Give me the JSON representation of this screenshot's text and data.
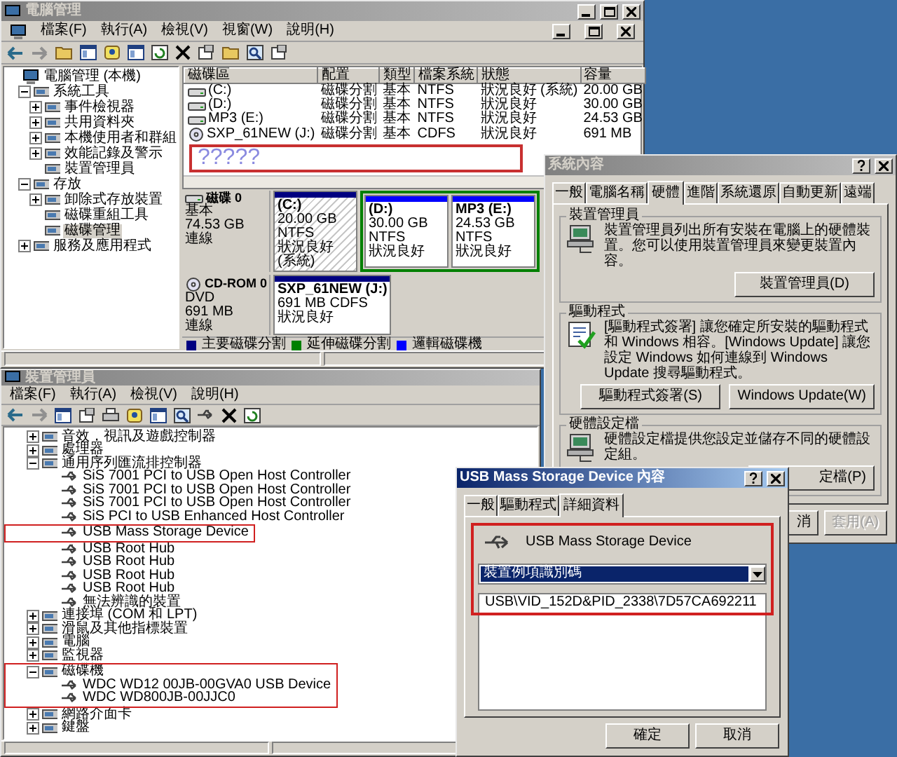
{
  "computer_management": {
    "title": "電腦管理",
    "menu": [
      "檔案(F)",
      "執行(A)",
      "檢視(V)",
      "視窗(W)",
      "說明(H)"
    ],
    "tree": [
      {
        "label": "電腦管理 (本機)",
        "selected": false,
        "children": [
          {
            "label": "系統工具",
            "expanded": true,
            "selected": false,
            "children": [
              {
                "label": "事件檢視器",
                "expanded": false,
                "selected": false
              },
              {
                "label": "共用資料夾",
                "expanded": false,
                "selected": false
              },
              {
                "label": "本機使用者和群組",
                "expanded": false,
                "selected": false
              },
              {
                "label": "效能記錄及警示",
                "expanded": false,
                "selected": false
              },
              {
                "label": "裝置管理員",
                "selected": false
              }
            ]
          },
          {
            "label": "存放",
            "expanded": true,
            "selected": false,
            "children": [
              {
                "label": "卸除式存放裝置",
                "expanded": false,
                "selected": false
              },
              {
                "label": "磁碟重組工具",
                "selected": false
              },
              {
                "label": "磁碟管理",
                "selected": true
              }
            ]
          },
          {
            "label": "服務及應用程式",
            "expanded": false,
            "selected": false
          }
        ]
      }
    ],
    "volumes": {
      "columns": [
        "磁碟區",
        "配置",
        "類型",
        "檔案系統",
        "狀態",
        "容量"
      ],
      "rows": [
        {
          "kind": "disk",
          "cells": [
            "(C:)",
            "磁碟分割",
            "基本",
            "NTFS",
            "狀況良好 (系統)",
            "20.00 GB"
          ]
        },
        {
          "kind": "disk",
          "cells": [
            "(D:)",
            "磁碟分割",
            "基本",
            "NTFS",
            "狀況良好",
            "30.00 GB"
          ]
        },
        {
          "kind": "disk",
          "cells": [
            "MP3 (E:)",
            "磁碟分割",
            "基本",
            "NTFS",
            "狀況良好",
            "24.53 GB"
          ]
        },
        {
          "kind": "cd",
          "cells": [
            "SXP_61NEW (J:)",
            "磁碟分割",
            "基本",
            "CDFS",
            "狀況良好",
            "691 MB"
          ]
        }
      ]
    },
    "annotation": "?????",
    "disks": [
      {
        "kind": "disk",
        "name": "磁碟 0",
        "type": "基本",
        "size": "74.53 GB",
        "status": "連線",
        "partitions": [
          {
            "kind": "primary",
            "selected": true,
            "label": "(C:)",
            "detail": "20.00 GB NTFS",
            "status": "狀況良好 (系統)"
          },
          {
            "kind": "logical",
            "selected": false,
            "label": "(D:)",
            "detail": "30.00 GB NTFS",
            "status": "狀況良好"
          },
          {
            "kind": "logical",
            "selected": false,
            "label": "MP3  (E:)",
            "detail": "24.53 GB NTFS",
            "status": "狀況良好"
          }
        ]
      },
      {
        "kind": "cd",
        "name": "CD-ROM 0",
        "type": "DVD",
        "size": "691 MB",
        "status": "連線",
        "partitions": [
          {
            "kind": "primary",
            "selected": false,
            "label": "SXP_61NEW  (J:)",
            "detail": "691 MB CDFS",
            "status": "狀況良好"
          }
        ]
      }
    ],
    "legend": [
      {
        "label": "主要磁碟分割",
        "color": "#000080"
      },
      {
        "label": "延伸磁碟分割",
        "color": "#008000"
      },
      {
        "label": "邏輯磁碟機",
        "color": "#0000ff"
      }
    ]
  },
  "device_manager": {
    "title": "裝置管理員",
    "menu": [
      "檔案(F)",
      "執行(A)",
      "檢視(V)",
      "說明(H)"
    ],
    "tree": [
      {
        "label": "音效，視訊及遊戲控制器",
        "expanded": false,
        "highlighted": false
      },
      {
        "label": "處理器",
        "expanded": false,
        "highlighted": false
      },
      {
        "label": "通用序列匯流排控制器",
        "expanded": true,
        "highlighted": false,
        "children": [
          {
            "label": "SiS 7001 PCI to USB Open Host Controller",
            "highlighted": false
          },
          {
            "label": "SiS 7001 PCI to USB Open Host Controller",
            "highlighted": false
          },
          {
            "label": "SiS 7001 PCI to USB Open Host Controller",
            "highlighted": false
          },
          {
            "label": "SiS PCI to USB Enhanced Host Controller",
            "highlighted": false
          },
          {
            "label": "USB Mass Storage Device",
            "highlighted": true
          },
          {
            "label": "USB Root Hub",
            "highlighted": false
          },
          {
            "label": "USB Root Hub",
            "highlighted": false
          },
          {
            "label": "USB Root Hub",
            "highlighted": false
          },
          {
            "label": "USB Root Hub",
            "highlighted": false
          },
          {
            "label": "無法辨識的裝置",
            "highlighted": false
          }
        ]
      },
      {
        "label": "連接埠 (COM 和 LPT)",
        "expanded": false,
        "highlighted": false
      },
      {
        "label": "滑鼠及其他指標裝置",
        "expanded": false,
        "highlighted": false
      },
      {
        "label": "電腦",
        "expanded": false,
        "highlighted": false
      },
      {
        "label": "監視器",
        "expanded": false,
        "highlighted": false
      },
      {
        "label": "磁碟機",
        "expanded": true,
        "highlighted": true,
        "children": [
          {
            "label": "WDC WD12 00JB-00GVA0 USB Device",
            "highlighted": false
          },
          {
            "label": "WDC WD800JB-00JJC0",
            "highlighted": false
          }
        ]
      },
      {
        "label": "網路介面卡",
        "expanded": false,
        "highlighted": false
      },
      {
        "label": "鍵盤",
        "expanded": false,
        "highlighted": false
      }
    ]
  },
  "system_properties": {
    "title": "系統內容",
    "tabs": [
      {
        "label": "一般",
        "selected": false
      },
      {
        "label": "電腦名稱",
        "selected": false
      },
      {
        "label": "硬體",
        "selected": true
      },
      {
        "label": "進階",
        "selected": false
      },
      {
        "label": "系統還原",
        "selected": false
      },
      {
        "label": "自動更新",
        "selected": false
      },
      {
        "label": "遠端",
        "selected": false
      }
    ],
    "groups": [
      {
        "title": "裝置管理員",
        "text": "裝置管理員列出所有安裝在電腦上的硬體裝置。您可以使用裝置管理員來變更裝置內容。",
        "buttons": [
          "裝置管理員(D)"
        ]
      },
      {
        "title": "驅動程式",
        "text": "[驅動程式簽署] 讓您確定所安裝的驅動程式和 Windows 相容。[Windows Update] 讓您設定 Windows 如何連線到 Windows Update 搜尋驅動程式。",
        "buttons": [
          "驅動程式簽署(S)",
          "Windows Update(W)"
        ]
      },
      {
        "title": "硬體設定檔",
        "text": "硬體設定檔提供您設定並儲存不同的硬體設定組。",
        "buttons": [
          "定檔(P)"
        ]
      }
    ],
    "buttons": [
      {
        "label": "消",
        "disabled": false
      },
      {
        "label": "套用(A)",
        "disabled": true
      }
    ]
  },
  "usb_properties": {
    "title": "USB Mass Storage Device 內容",
    "tabs": [
      {
        "label": "一般",
        "selected": false
      },
      {
        "label": "驅動程式",
        "selected": false
      },
      {
        "label": "詳細資料",
        "selected": true
      }
    ],
    "highlighted": true,
    "device_name": "USB Mass Storage Device",
    "property": "裝置例項識別碼",
    "values": [
      "USB\\VID_152D&PID_2338\\7D57CA692211"
    ],
    "buttons": [
      "確定",
      "取消"
    ]
  }
}
